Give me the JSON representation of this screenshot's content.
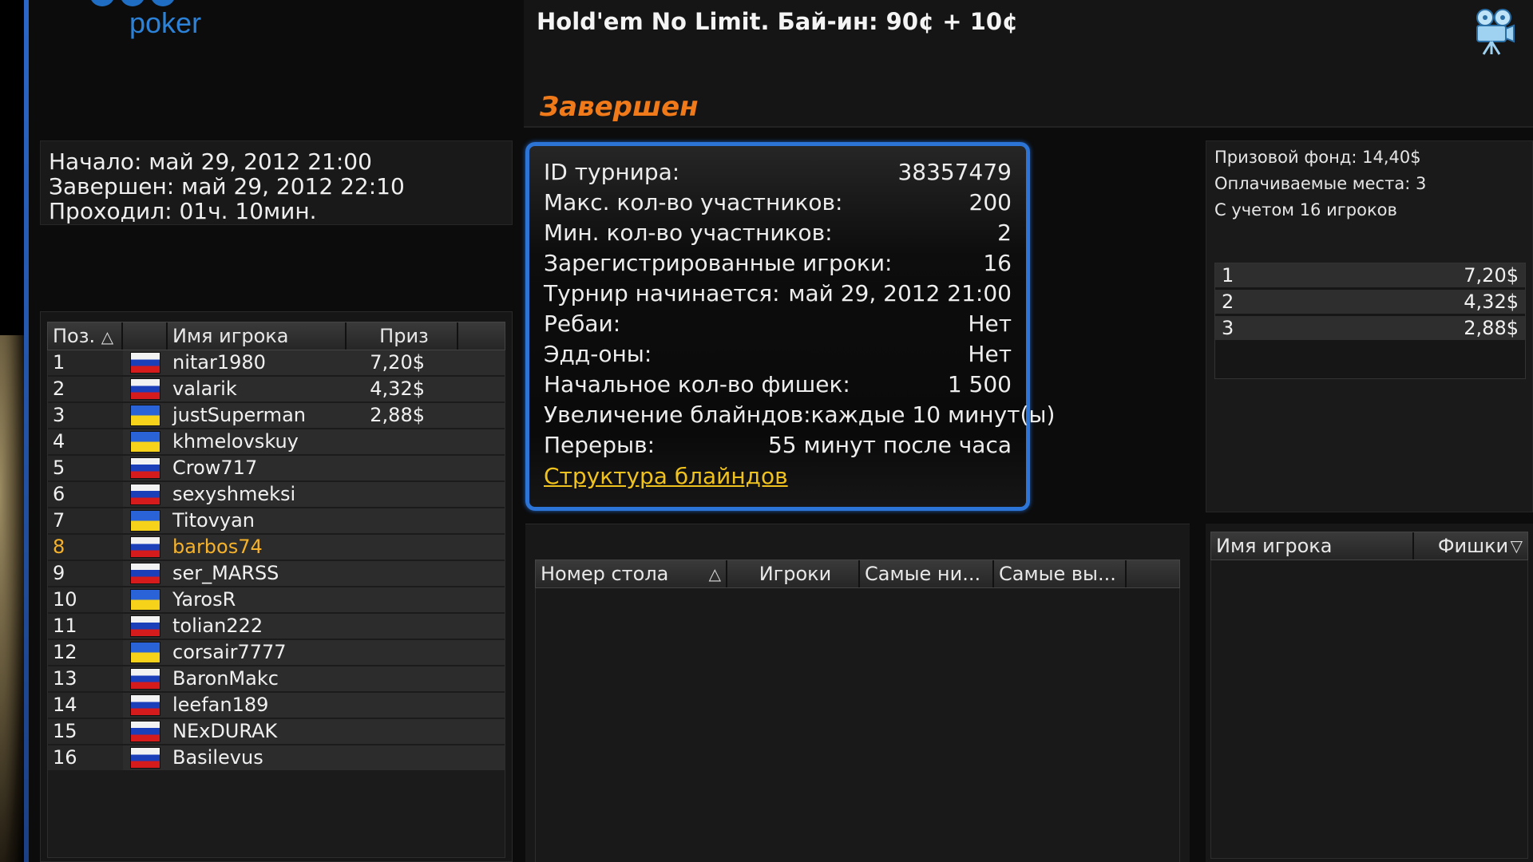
{
  "brand": {
    "logo_text": "poker"
  },
  "header": {
    "title": "Hold'em No Limit. Бай-ин: 90¢ + 10¢",
    "status": "Завершен"
  },
  "dates": {
    "start": "Начало: май 29, 2012 21:00",
    "end": "Завершен: май 29, 2012 22:10",
    "duration": "Проходил: 01ч. 10мин."
  },
  "players_table": {
    "columns": {
      "pos": "Поз.",
      "name": "Имя игрока",
      "prize": "Приз"
    },
    "rows": [
      {
        "pos": "1",
        "flag": "ru",
        "name": "nitar1980",
        "prize": "7,20$"
      },
      {
        "pos": "2",
        "flag": "ru",
        "name": "valarik",
        "prize": "4,32$"
      },
      {
        "pos": "3",
        "flag": "ua",
        "name": "justSuperman",
        "prize": "2,88$"
      },
      {
        "pos": "4",
        "flag": "ua",
        "name": "khmelovskuy",
        "prize": ""
      },
      {
        "pos": "5",
        "flag": "ru",
        "name": "Crow717",
        "prize": ""
      },
      {
        "pos": "6",
        "flag": "ru",
        "name": "sexyshmeksi",
        "prize": ""
      },
      {
        "pos": "7",
        "flag": "ua",
        "name": "Titovyan",
        "prize": ""
      },
      {
        "pos": "8",
        "flag": "ru",
        "name": "barbos74",
        "prize": "",
        "highlight": true
      },
      {
        "pos": "9",
        "flag": "ru",
        "name": "ser_MARSS",
        "prize": ""
      },
      {
        "pos": "10",
        "flag": "ua",
        "name": "YarosR",
        "prize": ""
      },
      {
        "pos": "11",
        "flag": "ru",
        "name": "tolian222",
        "prize": ""
      },
      {
        "pos": "12",
        "flag": "ua",
        "name": "corsair7777",
        "prize": ""
      },
      {
        "pos": "13",
        "flag": "ru",
        "name": "BaronMakc",
        "prize": ""
      },
      {
        "pos": "14",
        "flag": "ru",
        "name": "leefan189",
        "prize": ""
      },
      {
        "pos": "15",
        "flag": "ru",
        "name": "NExDURAK",
        "prize": ""
      },
      {
        "pos": "16",
        "flag": "ru",
        "name": "Basilevus",
        "prize": ""
      }
    ]
  },
  "info": {
    "rows": [
      {
        "label": "ID турнира:",
        "value": "38357479"
      },
      {
        "label": "Макс. кол-во участников:",
        "value": "200"
      },
      {
        "label": "Мин. кол-во участников:",
        "value": "2"
      },
      {
        "label": "Зарегистрированные игроки:",
        "value": "16"
      },
      {
        "label": "Турнир начинается:",
        "value": "май 29, 2012 21:00"
      },
      {
        "label": "Ребаи:",
        "value": "Нет"
      },
      {
        "label": "Эдд-оны:",
        "value": "Нет"
      },
      {
        "label": "Начальное кол-во фишек:",
        "value": "1 500"
      },
      {
        "label": "Увеличение блайндов:",
        "value": "каждые 10 минут(ы)"
      },
      {
        "label": "Перерыв:",
        "value": "55 минут после часа"
      }
    ],
    "blind_structure_link": "Структура блайндов"
  },
  "prize_pool": {
    "fund": "Призовой фонд: 14,40$",
    "paid_places": "Оплачиваемые места: 3",
    "players_note": "С учетом 16 игроков",
    "places": [
      {
        "place": "1",
        "amount": "7,20$"
      },
      {
        "place": "2",
        "amount": "4,32$"
      },
      {
        "place": "3",
        "amount": "2,88$"
      }
    ]
  },
  "tables_grid": {
    "columns": {
      "table_no": "Номер стола",
      "players": "Игроки",
      "lowest": "Самые ни...",
      "highest": "Самые вы..."
    }
  },
  "chips_grid": {
    "columns": {
      "name": "Имя игрока",
      "chips": "Фишки"
    }
  },
  "icons": {
    "sort_asc": "▲-outline",
    "sort_desc": "▼-outline",
    "camera": "movie-camera-icon"
  },
  "colors": {
    "accent_blue": "#2c74d6",
    "status_orange": "#f07a1a",
    "link_yellow": "#f0c21e",
    "highlight": "#f5b22a"
  }
}
